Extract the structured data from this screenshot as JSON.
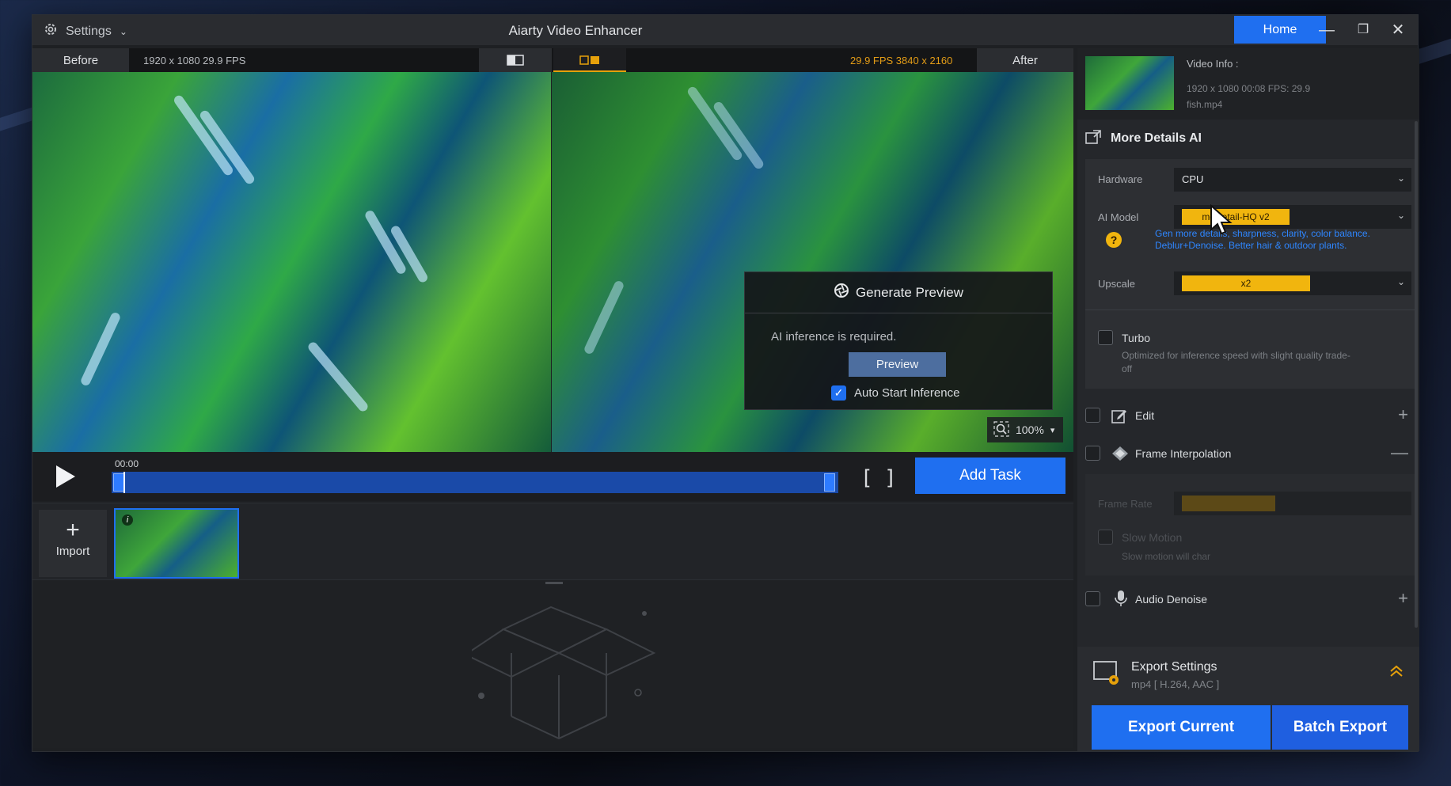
{
  "colors": {
    "accent": "#1f6ff0",
    "warning": "#f1b50e",
    "orange_text": "#e39c16"
  },
  "titlebar": {
    "settings_label": "Settings",
    "app_title": "Aiarty Video Enhancer",
    "home_label": "Home"
  },
  "compare": {
    "before_label": "Before",
    "before_info": "1920 x 1080  29.9 FPS",
    "after_info": "29.9 FPS  3840 x 2160",
    "after_label": "After"
  },
  "popup": {
    "title": "Generate Preview",
    "message": "AI inference is required.",
    "preview_label": "Preview",
    "auto_start_label": "Auto Start Inference",
    "auto_start_checked": true
  },
  "zoom": {
    "value": "100%"
  },
  "playback": {
    "time": "00:00",
    "add_task_label": "Add Task",
    "bracket_in": "[",
    "bracket_out": "]"
  },
  "media": {
    "import_label": "Import"
  },
  "video_info": {
    "title": "Video Info :",
    "meta": "1920 x 1080  00:08    FPS: 29.9",
    "file": "fish.mp4"
  },
  "enhance": {
    "section_title": "More Details AI",
    "hardware_label": "Hardware",
    "hardware_value": "CPU",
    "ai_model_label": "AI Model",
    "ai_model_value": "moDetail-HQ  v2",
    "ai_model_desc": "Gen more details, sharpness, clarity, color balance. Deblur+Denoise. Better hair & outdoor plants.",
    "upscale_label": "Upscale",
    "upscale_value": "x2",
    "turbo_label": "Turbo",
    "turbo_desc": "Optimized for inference speed with slight quality trade-off"
  },
  "features": {
    "edit_label": "Edit",
    "frame_interp_label": "Frame Interpolation",
    "frame_rate_label": "Frame Rate",
    "slow_motion_label": "Slow Motion",
    "slow_motion_desc": "Slow motion will char",
    "audio_denoise_label": "Audio Denoise"
  },
  "export": {
    "title": "Export Settings",
    "format": "mp4 [ H.264, AAC ]",
    "export_current_label": "Export Current",
    "batch_export_label": "Batch Export"
  }
}
